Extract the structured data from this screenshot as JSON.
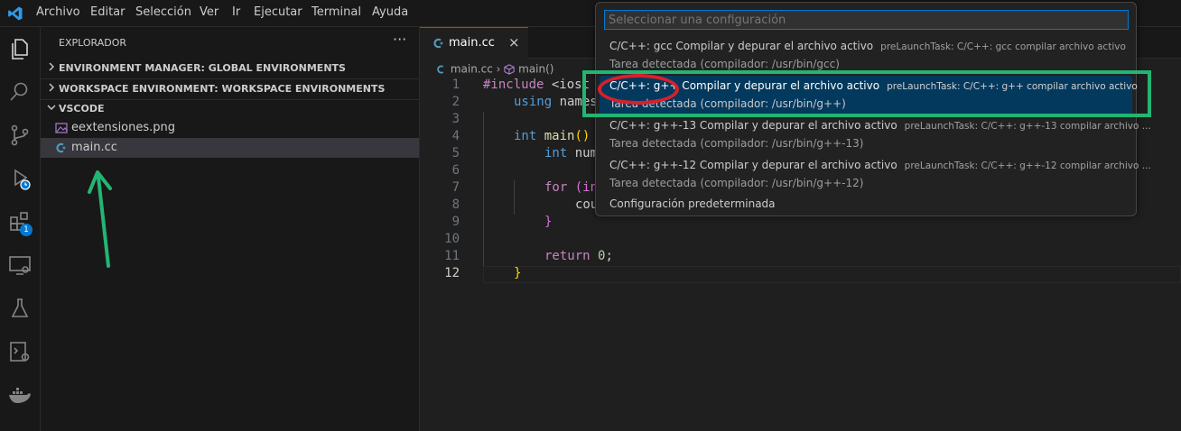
{
  "menu": [
    "Archivo",
    "Editar",
    "Selección",
    "Ver",
    "Ir",
    "Ejecutar",
    "Terminal",
    "Ayuda"
  ],
  "activity_bar": {
    "icons": [
      "explorer-icon",
      "search-icon",
      "source-control-icon",
      "run-debug-icon",
      "extensions-icon",
      "remote-explorer-icon",
      "testing-icon",
      "remote-settings-icon",
      "docker-icon"
    ],
    "extensions_badge": "1"
  },
  "sidebar": {
    "title": "EXPLORADOR",
    "more": "···",
    "sections": [
      {
        "label": "ENVIRONMENT MANAGER: GLOBAL ENVIRONMENTS",
        "expanded": false
      },
      {
        "label": "WORKSPACE ENVIRONMENT: WORKSPACE ENVIRONMENTS",
        "expanded": false
      },
      {
        "label": "VSCODE",
        "expanded": true
      }
    ],
    "files": [
      {
        "name": "eextensiones.png",
        "icon": "image-file-icon"
      },
      {
        "name": "main.cc",
        "icon": "cpp-file-icon",
        "selected": true
      }
    ]
  },
  "editor": {
    "tab": {
      "label": "main.cc",
      "close": "×"
    },
    "breadcrumb": {
      "file": "main.cc",
      "sep": "›",
      "symbol": "main()"
    },
    "line_numbers": [
      "1",
      "2",
      "3",
      "4",
      "5",
      "6",
      "7",
      "8",
      "9",
      "10",
      "11",
      "12"
    ],
    "code": {
      "l1_directive": "#include",
      "l1_rest": " <iost",
      "l2_kw": "using",
      "l2_rest": " names",
      "l4_type": "int",
      "l4_fn": "main",
      "l4_paren": "()",
      "l5_type": "int",
      "l5_rest": " num",
      "l7_kw": "for",
      "l7_rest": " (in",
      "l8_rest": "cou",
      "l9_brace": "}",
      "l11_kw": "return",
      "l11_num": "0",
      "l11_semi": ";",
      "l12_brace": "}"
    }
  },
  "quick_pick": {
    "placeholder": "Seleccionar una configuración",
    "items": [
      {
        "label": "C/C++: gcc Compilar y depurar el archivo activo",
        "description": "preLaunchTask: C/C++: gcc compilar archivo activo",
        "detail": "Tarea detectada (compilador: /usr/bin/gcc)",
        "selected": false
      },
      {
        "label": "C/C++: g++ Compilar y depurar el archivo activo",
        "description": "preLaunchTask: C/C++: g++ compilar archivo activo",
        "detail": "Tarea detectada (compilador: /usr/bin/g++)",
        "selected": true
      },
      {
        "label": "C/C++: g++-13 Compilar y depurar el archivo activo",
        "description": "preLaunchTask: C/C++: g++-13 compilar archivo ...",
        "detail": "Tarea detectada (compilador: /usr/bin/g++-13)",
        "selected": false
      },
      {
        "label": "C/C++: g++-12 Compilar y depurar el archivo activo",
        "description": "preLaunchTask: C/C++: g++-12 compilar archivo ...",
        "detail": "Tarea detectada (compilador: /usr/bin/g++-12)",
        "selected": false
      }
    ],
    "default_config": "Configuración predeterminada"
  },
  "annotations": {
    "highlight_color": "#22b573",
    "circle_color": "#d7202c",
    "arrow_color": "#22b573"
  },
  "colors": {
    "accent": "#0078d4",
    "selection": "#04395e"
  }
}
